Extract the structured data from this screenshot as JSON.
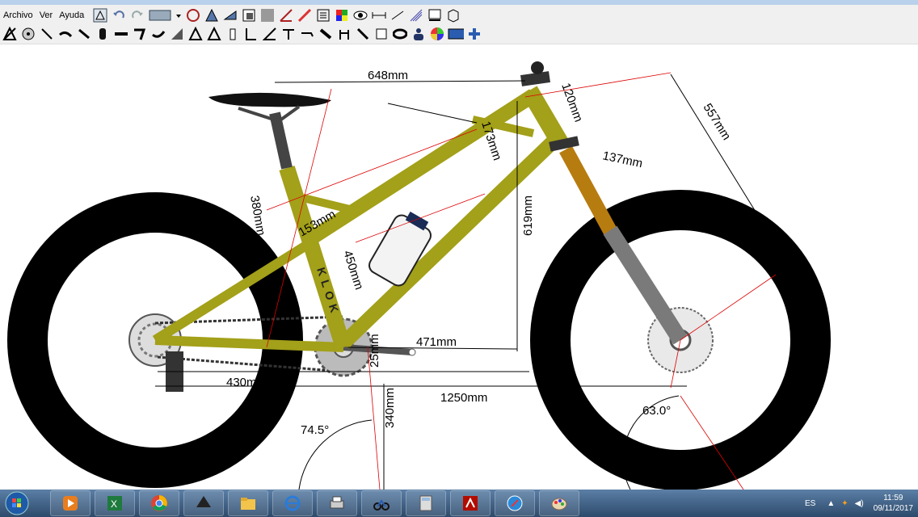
{
  "menu": [
    "Archivo",
    "Ver",
    "Ayuda"
  ],
  "toolbar_icons": [
    "frame-icon",
    "wheel-icon",
    "pencil-icon",
    "crank-icon",
    "hub-icon",
    "chain-icon",
    "brake-icon",
    "fork-icon",
    "stem-icon",
    "triangle-icon",
    "triangle-icon",
    "bottle-icon",
    "seat-icon",
    "angle-icon",
    "angle-icon",
    "tape-icon",
    "shock-icon",
    "grips-icon",
    "wrench-icon",
    "square-icon",
    "tire-icon",
    "rider-icon",
    "color-wheel-icon",
    "bike-icon",
    "plus-icon"
  ],
  "toolbar_top_icons": [
    "frame-icon",
    "undo-icon",
    "redo-icon",
    "export-icon",
    "dropdown-icon",
    "wheel-icon",
    "frame-icon",
    "frame-icon",
    "frame-icon",
    "grid-icon",
    "angle-icon",
    "angle-icon",
    "list-icon",
    "palette-icon",
    "eye-icon",
    "ruler-icon",
    "note-icon",
    "cables-icon",
    "monitor-icon",
    "box-icon"
  ],
  "dimensions": {
    "top_span": "648mm",
    "head_tube": "120mm",
    "reach": "557mm",
    "stem_stack": "137mm",
    "top_tube_a": "173mm",
    "stack": "619mm",
    "seat_cluster": "380mm",
    "seat_tube_a": "153mm",
    "seat_tube": "450mm",
    "front_center": "471mm",
    "bb_drop": "25mm",
    "chainstay": "430mm",
    "wheelbase": "1250mm",
    "bb_height": "340mm",
    "seat_angle": "74.5°",
    "head_angle": "63.0°"
  },
  "frame_brand": "KLOK",
  "colors": {
    "frame": "#a3a019",
    "tire": "#000000",
    "fork": "#7a7a7a",
    "fork_upper": "#b77c10",
    "titlebar": "#b9d1ea",
    "taskbar": "#2d4a6b"
  },
  "taskbar": {
    "apps": [
      "media-player-icon",
      "excel-icon",
      "chrome-icon",
      "inkscape-icon",
      "folder-icon",
      "ie-icon",
      "printer-icon",
      "bike-app-icon",
      "calculator-icon",
      "acrobat-icon",
      "safari-icon",
      "paint-icon"
    ],
    "lang": "ES",
    "time": "11:59",
    "date": "09/11/2017"
  }
}
